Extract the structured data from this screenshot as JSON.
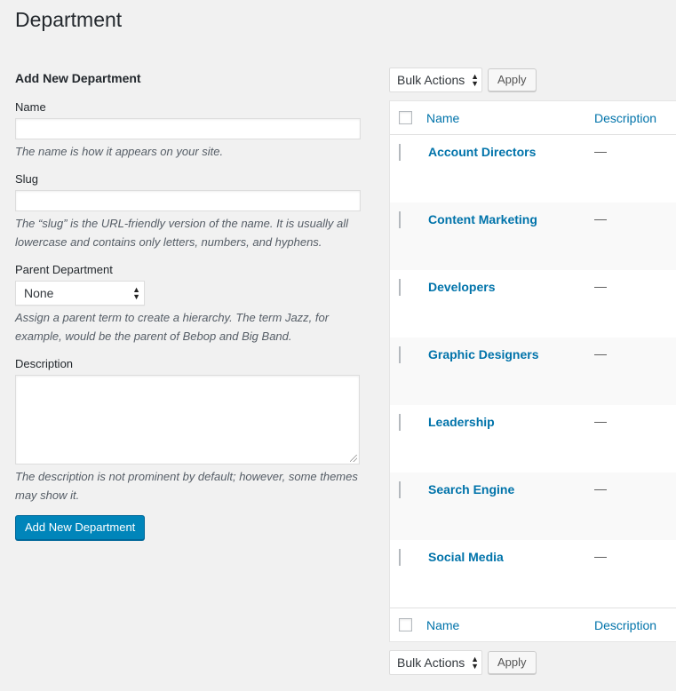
{
  "page": {
    "title": "Department"
  },
  "form": {
    "heading": "Add New Department",
    "name_label": "Name",
    "name_value": "",
    "name_help": "The name is how it appears on your site.",
    "slug_label": "Slug",
    "slug_value": "",
    "slug_help": "The “slug” is the URL-friendly version of the name. It is usually all lowercase and contains only letters, numbers, and hyphens.",
    "parent_label": "Parent Department",
    "parent_selected": "None",
    "parent_help": "Assign a parent term to create a hierarchy. The term Jazz, for example, would be the parent of Bebop and Big Band.",
    "description_label": "Description",
    "description_value": "",
    "description_help": "The description is not prominent by default; however, some themes may show it.",
    "submit_label": "Add New Department"
  },
  "tablenav": {
    "bulk_actions": "Bulk Actions",
    "apply_label": "Apply"
  },
  "table": {
    "columns": {
      "name": "Name",
      "description": "Description"
    },
    "rows": [
      {
        "name": "Account Directors",
        "description": "—"
      },
      {
        "name": "Content Marketing",
        "description": "—"
      },
      {
        "name": "Developers",
        "description": "—"
      },
      {
        "name": "Graphic Designers",
        "description": "—"
      },
      {
        "name": "Leadership",
        "description": "—"
      },
      {
        "name": "Search Engine",
        "description": "—"
      },
      {
        "name": "Social Media",
        "description": "—"
      }
    ]
  },
  "colors": {
    "background": "#f1f1f1",
    "link": "#0073aa",
    "primary_button": "#0085ba"
  },
  "icons": {
    "select_arrows": "up-down-arrows-icon",
    "resize_grip": "resize-grip-icon"
  }
}
